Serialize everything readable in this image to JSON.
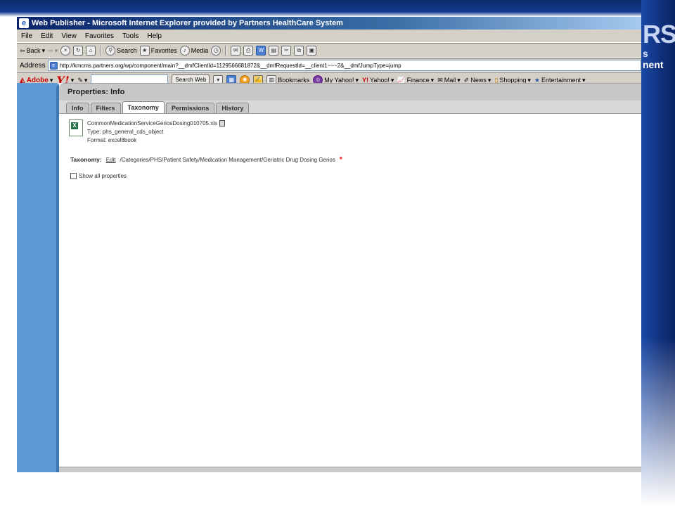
{
  "slide": {
    "logo_text": "RS",
    "sub1": "s",
    "sub2": "nent"
  },
  "window": {
    "title": "Web Publisher - Microsoft Internet Explorer provided by Partners HealthCare System"
  },
  "menu": [
    "File",
    "Edit",
    "View",
    "Favorites",
    "Tools",
    "Help"
  ],
  "toolbar": {
    "back": "Back",
    "search": "Search",
    "favorites": "Favorites",
    "media": "Media"
  },
  "address": {
    "label": "Address",
    "url": "http://kmcms.partners.org/wp/component/main?__dmfClientId=1129566681872&__dmfRequestId=__client1~~~2&__dmfJumpType=jump"
  },
  "links": {
    "adobe": "Adobe",
    "yahoo": "Y!",
    "search_button": "Search Web",
    "bookmarks": "Bookmarks",
    "my_yahoo": "My Yahoo!",
    "yahoo_link": "Yahoo!",
    "finance": "Finance",
    "mail": "Mail",
    "news": "News",
    "shopping": "Shopping",
    "entertainment": "Entertainment"
  },
  "properties": {
    "header": "Properties: Info",
    "tabs": [
      {
        "label": "Info",
        "active": false
      },
      {
        "label": "Filters",
        "active": false
      },
      {
        "label": "Taxonomy",
        "active": true
      },
      {
        "label": "Permissions",
        "active": false
      },
      {
        "label": "History",
        "active": false
      }
    ],
    "file": {
      "name": "CommonMedicationServiceGeriosDosing010705.xls",
      "type": "Type: phs_general_cds_object",
      "format": "Format: excel8book"
    },
    "taxonomy_label": "Taxonomy:",
    "edit_link": "Edit",
    "taxonomy_path": "/Categories/PHS/Patient Safety/Medication Management/Geriatric Drug Dosing Gerios",
    "required_mark": "*",
    "show_all": "Show all properties"
  }
}
